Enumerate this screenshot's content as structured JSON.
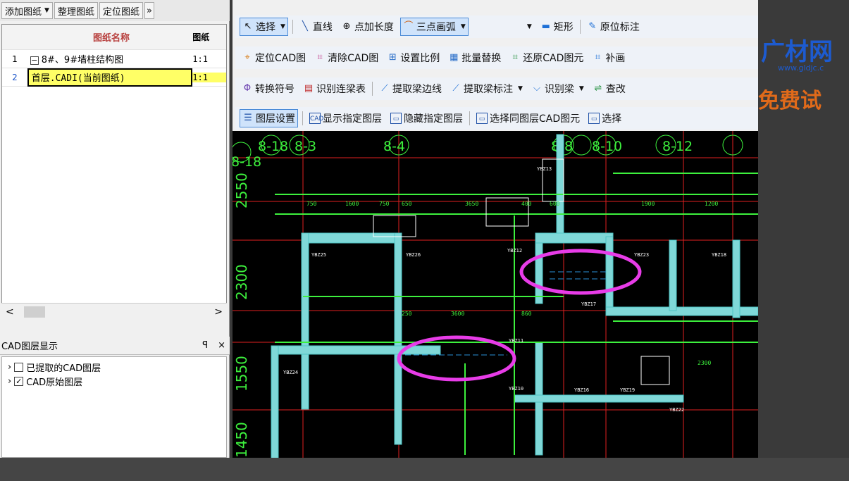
{
  "left_toolbar": {
    "add": "添加图纸",
    "organize": "整理图纸",
    "locate": "定位图纸",
    "more": "»"
  },
  "table": {
    "headers": [
      "",
      "图纸名称",
      "图纸"
    ],
    "rows": [
      {
        "num": "1",
        "name": "8#、9#墙柱结构图",
        "scale": "1:1",
        "expand": "−"
      },
      {
        "num": "2",
        "name": "首层.CADI(当前图纸)",
        "scale": "1:1"
      }
    ]
  },
  "hscroll": {
    "left": "<",
    "right": ">"
  },
  "layer_panel": {
    "title": "CAD图层显示",
    "pin": "ꟼ",
    "close": "×",
    "items": [
      {
        "label": "已提取的CAD图层",
        "checked": false,
        "check_glyph": ""
      },
      {
        "label": "CAD原始图层",
        "checked": true,
        "check_glyph": "✓"
      }
    ]
  },
  "toolbar1": {
    "select": "选择",
    "line": "直线",
    "point_len": "点加长度",
    "arc": "三点画弧",
    "rect": "矩形",
    "in_place": "原位标注"
  },
  "toolbar2": {
    "locate_cad": "定位CAD图",
    "clear_cad": "清除CAD图",
    "set_scale": "设置比例",
    "batch_replace": "批量替换",
    "restore_cad": "还原CAD图元",
    "supplement": "补画"
  },
  "toolbar3": {
    "convert_symbol": "转换符号",
    "identify_beam_table": "识别连梁表",
    "extract_beam_edge": "提取梁边线",
    "extract_beam_label": "提取梁标注",
    "identify_beam": "识别梁",
    "check": "查改"
  },
  "toolbar4": {
    "layer_settings": "图层设置",
    "show_layer": "显示指定图层",
    "hide_layer": "隐藏指定图层",
    "select_same_layer": "选择同图层CAD图元",
    "select": "选择"
  },
  "logo": {
    "brand": "广材网",
    "url": "www.gldjc.c",
    "promo": "免费试"
  },
  "drawing": {
    "grid_labels": [
      "8-18",
      "8-3",
      "8-4",
      "8-8",
      "8-10",
      "8-12"
    ],
    "row_labels": [
      "2550",
      "2300",
      "1550",
      "1450"
    ],
    "components": [
      "YBZ13",
      "YBZ12",
      "YBZ25",
      "YBZ26",
      "YBZ17",
      "YBZ18",
      "YBZ23",
      "YBZ24",
      "YBZ10",
      "YBZ11",
      "YBZ16",
      "YBZ19",
      "YBZ22"
    ],
    "dims": [
      "750",
      "1600",
      "750",
      "650",
      "3650",
      "400",
      "600",
      "1900",
      "1200",
      "250",
      "3600",
      "860",
      "2300"
    ]
  },
  "colors": {
    "highlight": "#ffff66",
    "magenta": "#e83ce8",
    "green": "#3df03d",
    "red": "#e02020",
    "cyan": "#4ec3c3"
  }
}
